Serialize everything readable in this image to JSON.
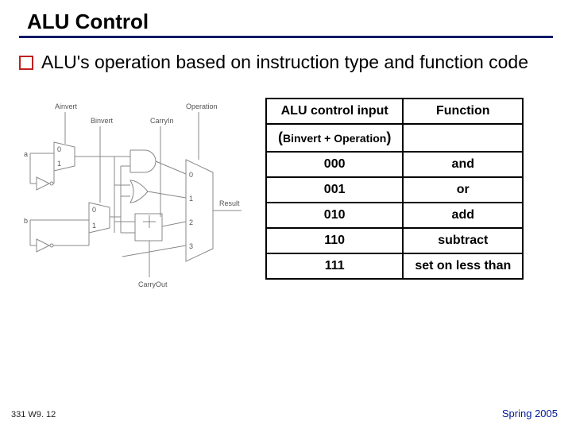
{
  "title": "ALU Control",
  "bullet": "ALU's operation based on instruction type and function code",
  "table": {
    "header_input": "ALU control input",
    "header_function": "Function",
    "subheader": "Binvert + Operation",
    "rows": [
      {
        "code": "000",
        "fn": "and"
      },
      {
        "code": "001",
        "fn": "or"
      },
      {
        "code": "010",
        "fn": "add"
      },
      {
        "code": "110",
        "fn": "subtract"
      },
      {
        "code": "111",
        "fn": "set on less than"
      }
    ]
  },
  "diagram": {
    "label_ainvert": "Ainvert",
    "label_binvert": "Binvert",
    "label_operation": "Operation",
    "label_carryin": "CarryIn",
    "label_carryout": "CarryOut",
    "label_result": "Result",
    "label_a": "a",
    "label_b": "b",
    "mux_vals": [
      "0",
      "1",
      "0",
      "1",
      "0",
      "1",
      "2",
      "3"
    ]
  },
  "footer_left": "331 W9. 12",
  "footer_right": "Spring 2005"
}
